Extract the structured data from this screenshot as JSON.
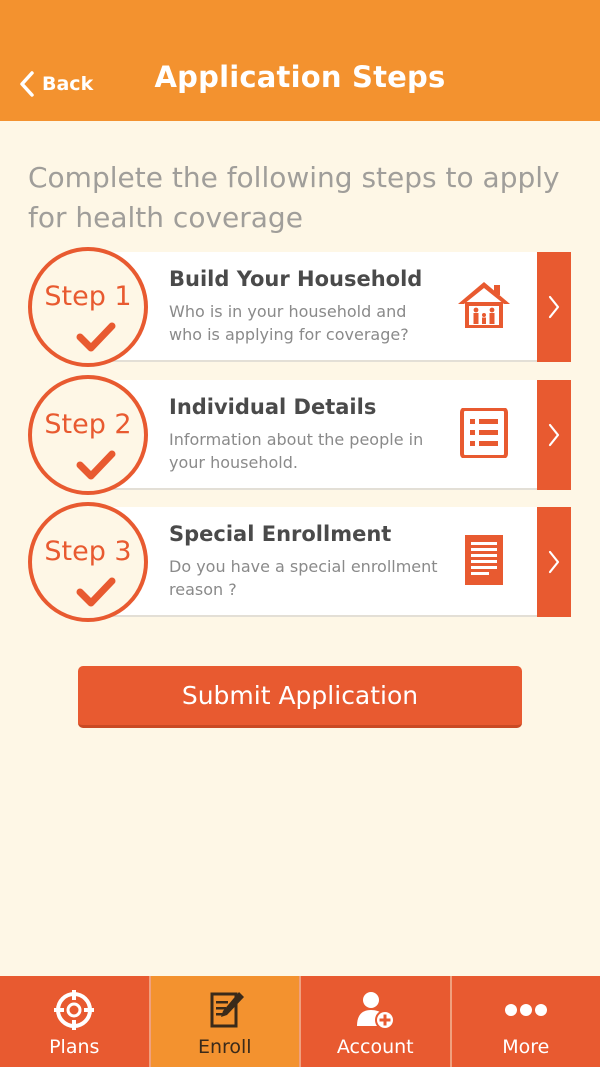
{
  "header": {
    "back_label": "Back",
    "title": "Application Steps"
  },
  "intro": "Complete the following steps to apply for health coverage",
  "steps": [
    {
      "step_label": "Step 1",
      "title": "Build Your Household",
      "description": "Who is in your household and who is applying for coverage?",
      "icon": "household-icon",
      "completed": true
    },
    {
      "step_label": "Step 2",
      "title": "Individual Details",
      "description": "Information about the people in your household.",
      "icon": "list-icon",
      "completed": true
    },
    {
      "step_label": "Step 3",
      "title": "Special Enrollment",
      "description": "Do you have a special enrollment reason ?",
      "icon": "document-icon",
      "completed": true
    }
  ],
  "submit_label": "Submit Application",
  "tabbar": {
    "tabs": [
      {
        "label": "Plans",
        "icon": "crosshair-icon",
        "active": false
      },
      {
        "label": "Enroll",
        "icon": "edit-icon",
        "active": true
      },
      {
        "label": "Account",
        "icon": "add-user-icon",
        "active": false
      },
      {
        "label": "More",
        "icon": "more-icon",
        "active": false
      }
    ]
  },
  "colors": {
    "header": "#f3922f",
    "accent": "#e85a30",
    "background": "#fef7e6"
  }
}
